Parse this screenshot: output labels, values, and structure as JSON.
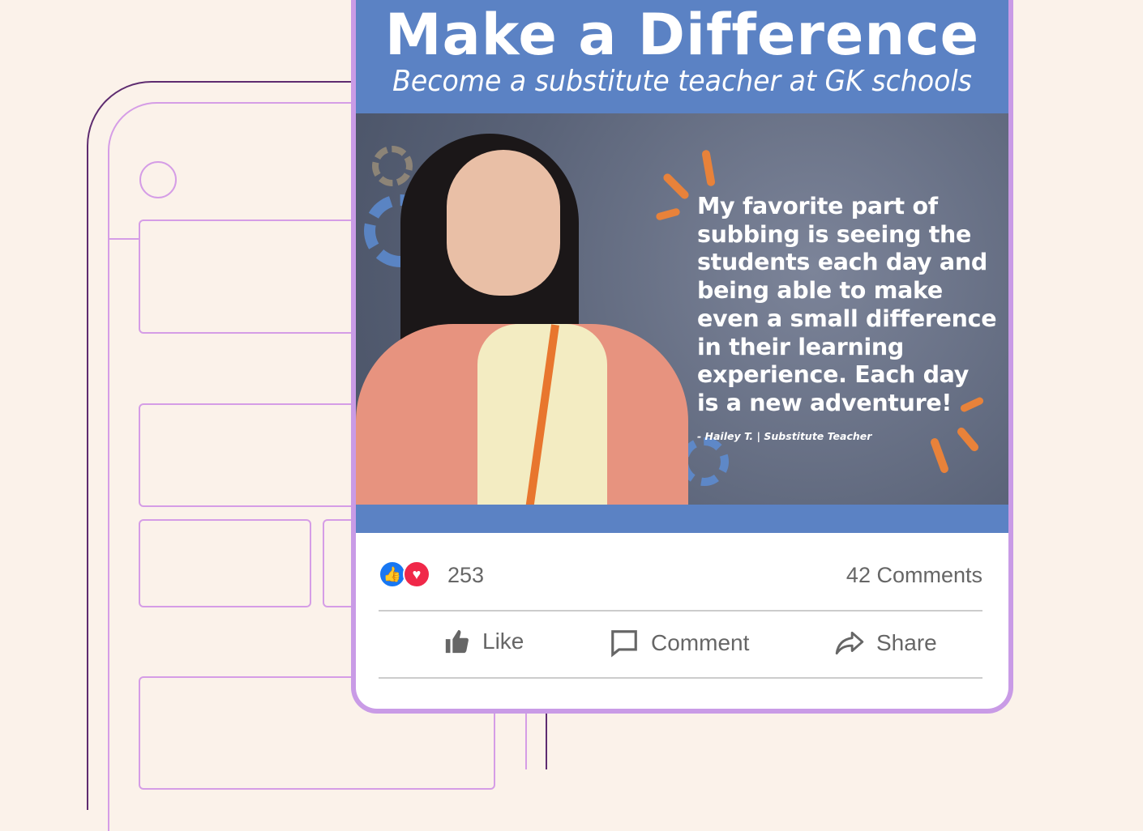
{
  "header": {
    "title": "Make a Difference",
    "subtitle": "Become a substitute teacher at GK schools"
  },
  "quote": {
    "text": "My favorite part of\nsubbing is seeing the\nstudents each day and\nbeing able to make\neven a small difference\nin their learning\nexperience. Each day\nis a new adventure!",
    "attribution": "- Hailey T. | Substitute Teacher"
  },
  "stats": {
    "reactions": "253",
    "comments": "42 Comments"
  },
  "actions": {
    "like": "Like",
    "comment": "Comment",
    "share": "Share"
  },
  "colors": {
    "header": "#5b82c4",
    "like": "#1877f2",
    "love": "#f02849"
  }
}
